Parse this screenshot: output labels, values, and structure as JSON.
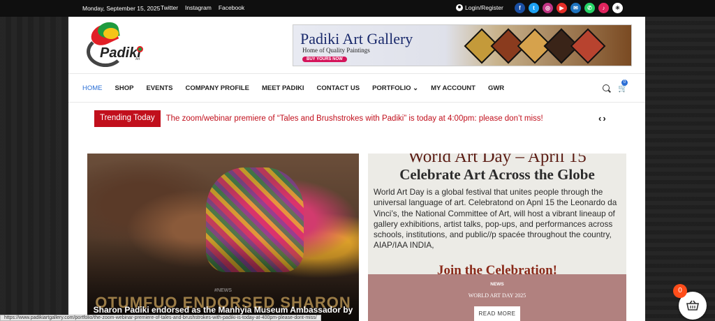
{
  "topbar": {
    "date": "Monday, September 15, 2025",
    "links": [
      "Twitter",
      "Instagram",
      "Facebook"
    ],
    "login": "Login/Register",
    "social": [
      {
        "name": "facebook-icon",
        "glyph": "f",
        "color": "#1a4fa3"
      },
      {
        "name": "twitter-icon",
        "glyph": "t",
        "color": "#1da1f2"
      },
      {
        "name": "instagram-icon",
        "glyph": "◎",
        "color": "#c13584"
      },
      {
        "name": "youtube-icon",
        "glyph": "▶",
        "color": "#e52d27"
      },
      {
        "name": "email-icon",
        "glyph": "✉",
        "color": "#1e73be"
      },
      {
        "name": "whatsapp-icon",
        "glyph": "✆",
        "color": "#25d366"
      },
      {
        "name": "tiktok-icon",
        "glyph": "♪",
        "color": "#e0245e"
      },
      {
        "name": "settings-icon",
        "glyph": "✳",
        "color": "#ffffff"
      }
    ]
  },
  "logo": {
    "text": "Padiki",
    "sub": "Art"
  },
  "banner": {
    "title": "Padiki Art Gallery",
    "subtitle": "Home of Quality Paintings",
    "button": "BUY YOURS NOW"
  },
  "nav": {
    "items": [
      "HOME",
      "SHOP",
      "EVENTS",
      "COMPANY PROFILE",
      "MEET PADIKI",
      "CONTACT US",
      "PORTFOLIO ⌄",
      "MY ACCOUNT",
      "GWR"
    ],
    "cart_count": "0"
  },
  "trending": {
    "label": "Trending Today",
    "message": "The zoom/webinar premiere of “Tales and Brushstrokes with Padiki” is today at 4:00pm: please don’t miss!",
    "arrows": "‹›"
  },
  "card1": {
    "category": "#NEWS",
    "overlay_text": "OTUMFUO ENDORSED SHARON",
    "headline": "Sharon Padiki endorsed as the Manhyia Museum Ambassador by"
  },
  "card2": {
    "heading": "World Art Day – April 15",
    "subheading": "Celebrate Art Across the Globe",
    "body": "World Art Day is a global festival that unites people through the universal language of art. Celebratond on Apnl 15 the Leonardo da Vinci’s, the National Committee of Art, will host a vibrant lineaup of gallery exhibitions, artist talks, pop-ups, and performances across schools, institutions, and public//p spacée throughout the country, AIAP/IAA INDIA,",
    "join": "Join the Celebration!",
    "category": "NEWS",
    "title": "WORLD ART DAY 2025",
    "button": "READ MORE"
  },
  "statusbar": {
    "url": "https://www.padikiartgallery.com/portfolio/the-zoom-webinar-premiere-of-tales-and-brushstrokes-with-padiki-is-today-at-400pm-please-dont-miss/"
  },
  "floatcart": {
    "count": "0"
  }
}
